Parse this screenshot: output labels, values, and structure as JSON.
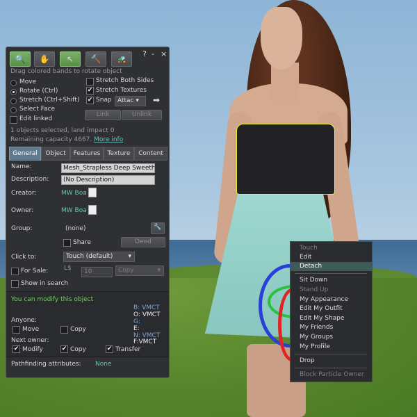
{
  "floater": {
    "hint": "Drag colored bands to rotate object",
    "title_icons": {
      "help": "?",
      "minimize": "-",
      "close": "×"
    },
    "tools": [
      {
        "name": "focus-tool",
        "glyph": "🔍"
      },
      {
        "name": "move-tool",
        "glyph": "✋"
      },
      {
        "name": "edit-tool",
        "glyph": "↖"
      },
      {
        "name": "create-tool",
        "glyph": "🔨"
      },
      {
        "name": "land-tool",
        "glyph": "🚜"
      }
    ],
    "modes": {
      "move": "Move",
      "rotate": "Rotate (Ctrl)",
      "stretch": "Stretch (Ctrl+Shift)",
      "select_face": "Select Face",
      "edit_linked": "Edit linked"
    },
    "options": {
      "stretch_both": "Stretch Both Sides",
      "stretch_textures": "Stretch Textures",
      "snap": "Snap",
      "snap_value": "Attac",
      "link": "Link",
      "unlink": "Unlink"
    },
    "status": {
      "selected": "1 objects selected, land impact 0",
      "remaining": "Remaining capacity 4667.",
      "more_info": "More info"
    },
    "tabs": [
      "General",
      "Object",
      "Features",
      "Texture",
      "Content"
    ],
    "general": {
      "name_label": "Name:",
      "name_value": "Mesh_Strapless Deep Sweethe",
      "desc_label": "Description:",
      "desc_value": "(No Description)",
      "creator_label": "Creator:",
      "creator_value": "MW Boa",
      "owner_label": "Owner:",
      "owner_value": "MW Boa",
      "group_label": "Group:",
      "group_value": "(none)",
      "share": "Share",
      "deed": "Deed",
      "click_label": "Click to:",
      "click_value": "Touch  (default)",
      "for_sale": "For Sale:",
      "currency": "L$",
      "price": "10",
      "sale_type": "Copy",
      "show_search": "Show in search",
      "modify_notice": "You can modify this object",
      "anyone": "Anyone:",
      "perm_move": "Move",
      "perm_copy": "Copy",
      "next_owner": "Next owner:",
      "perm_modify": "Modify",
      "perm_copy2": "Copy",
      "perm_transfer": "Transfer",
      "perm_codes": {
        "b": "B: VMCT",
        "o": "O: VMCT",
        "g": "G:",
        "e": "E:",
        "n": "N: VMCT",
        "f": "F:VMCT"
      },
      "pathfinding_label": "Pathfinding attributes:",
      "pathfinding_value": "None"
    }
  },
  "context_menu": {
    "items": [
      {
        "label": "Touch",
        "disabled": true
      },
      {
        "label": "Edit",
        "disabled": false
      },
      {
        "label": "Detach",
        "disabled": false,
        "highlighted": true
      },
      {
        "label": "Sit Down",
        "disabled": false
      },
      {
        "label": "Stand Up",
        "disabled": true
      },
      {
        "label": "My Appearance",
        "disabled": false
      },
      {
        "label": "Edit My Outfit",
        "disabled": false
      },
      {
        "label": "Edit My Shape",
        "disabled": false
      },
      {
        "label": "My Friends",
        "disabled": false
      },
      {
        "label": "My Groups",
        "disabled": false
      },
      {
        "label": "My Profile",
        "disabled": false
      },
      {
        "label": "Drop",
        "disabled": false
      },
      {
        "label": "Block Particle Owner",
        "disabled": true
      }
    ]
  },
  "colors": {
    "selection_outline": "#e6f020",
    "link": "#6ec0b8",
    "notice": "#79c86a",
    "active_tool": "#6aa558"
  }
}
